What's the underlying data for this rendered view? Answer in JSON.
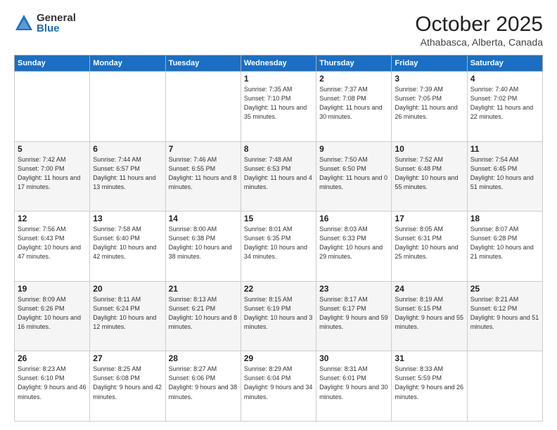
{
  "logo": {
    "general": "General",
    "blue": "Blue"
  },
  "header": {
    "month": "October 2025",
    "location": "Athabasca, Alberta, Canada"
  },
  "days_of_week": [
    "Sunday",
    "Monday",
    "Tuesday",
    "Wednesday",
    "Thursday",
    "Friday",
    "Saturday"
  ],
  "weeks": [
    [
      {
        "day": "",
        "info": ""
      },
      {
        "day": "",
        "info": ""
      },
      {
        "day": "",
        "info": ""
      },
      {
        "day": "1",
        "info": "Sunrise: 7:35 AM\nSunset: 7:10 PM\nDaylight: 11 hours\nand 35 minutes."
      },
      {
        "day": "2",
        "info": "Sunrise: 7:37 AM\nSunset: 7:08 PM\nDaylight: 11 hours\nand 30 minutes."
      },
      {
        "day": "3",
        "info": "Sunrise: 7:39 AM\nSunset: 7:05 PM\nDaylight: 11 hours\nand 26 minutes."
      },
      {
        "day": "4",
        "info": "Sunrise: 7:40 AM\nSunset: 7:02 PM\nDaylight: 11 hours\nand 22 minutes."
      }
    ],
    [
      {
        "day": "5",
        "info": "Sunrise: 7:42 AM\nSunset: 7:00 PM\nDaylight: 11 hours\nand 17 minutes."
      },
      {
        "day": "6",
        "info": "Sunrise: 7:44 AM\nSunset: 6:57 PM\nDaylight: 11 hours\nand 13 minutes."
      },
      {
        "day": "7",
        "info": "Sunrise: 7:46 AM\nSunset: 6:55 PM\nDaylight: 11 hours\nand 8 minutes."
      },
      {
        "day": "8",
        "info": "Sunrise: 7:48 AM\nSunset: 6:53 PM\nDaylight: 11 hours\nand 4 minutes."
      },
      {
        "day": "9",
        "info": "Sunrise: 7:50 AM\nSunset: 6:50 PM\nDaylight: 11 hours\nand 0 minutes."
      },
      {
        "day": "10",
        "info": "Sunrise: 7:52 AM\nSunset: 6:48 PM\nDaylight: 10 hours\nand 55 minutes."
      },
      {
        "day": "11",
        "info": "Sunrise: 7:54 AM\nSunset: 6:45 PM\nDaylight: 10 hours\nand 51 minutes."
      }
    ],
    [
      {
        "day": "12",
        "info": "Sunrise: 7:56 AM\nSunset: 6:43 PM\nDaylight: 10 hours\nand 47 minutes."
      },
      {
        "day": "13",
        "info": "Sunrise: 7:58 AM\nSunset: 6:40 PM\nDaylight: 10 hours\nand 42 minutes."
      },
      {
        "day": "14",
        "info": "Sunrise: 8:00 AM\nSunset: 6:38 PM\nDaylight: 10 hours\nand 38 minutes."
      },
      {
        "day": "15",
        "info": "Sunrise: 8:01 AM\nSunset: 6:35 PM\nDaylight: 10 hours\nand 34 minutes."
      },
      {
        "day": "16",
        "info": "Sunrise: 8:03 AM\nSunset: 6:33 PM\nDaylight: 10 hours\nand 29 minutes."
      },
      {
        "day": "17",
        "info": "Sunrise: 8:05 AM\nSunset: 6:31 PM\nDaylight: 10 hours\nand 25 minutes."
      },
      {
        "day": "18",
        "info": "Sunrise: 8:07 AM\nSunset: 6:28 PM\nDaylight: 10 hours\nand 21 minutes."
      }
    ],
    [
      {
        "day": "19",
        "info": "Sunrise: 8:09 AM\nSunset: 6:26 PM\nDaylight: 10 hours\nand 16 minutes."
      },
      {
        "day": "20",
        "info": "Sunrise: 8:11 AM\nSunset: 6:24 PM\nDaylight: 10 hours\nand 12 minutes."
      },
      {
        "day": "21",
        "info": "Sunrise: 8:13 AM\nSunset: 6:21 PM\nDaylight: 10 hours\nand 8 minutes."
      },
      {
        "day": "22",
        "info": "Sunrise: 8:15 AM\nSunset: 6:19 PM\nDaylight: 10 hours\nand 3 minutes."
      },
      {
        "day": "23",
        "info": "Sunrise: 8:17 AM\nSunset: 6:17 PM\nDaylight: 9 hours\nand 59 minutes."
      },
      {
        "day": "24",
        "info": "Sunrise: 8:19 AM\nSunset: 6:15 PM\nDaylight: 9 hours\nand 55 minutes."
      },
      {
        "day": "25",
        "info": "Sunrise: 8:21 AM\nSunset: 6:12 PM\nDaylight: 9 hours\nand 51 minutes."
      }
    ],
    [
      {
        "day": "26",
        "info": "Sunrise: 8:23 AM\nSunset: 6:10 PM\nDaylight: 9 hours\nand 46 minutes."
      },
      {
        "day": "27",
        "info": "Sunrise: 8:25 AM\nSunset: 6:08 PM\nDaylight: 9 hours\nand 42 minutes."
      },
      {
        "day": "28",
        "info": "Sunrise: 8:27 AM\nSunset: 6:06 PM\nDaylight: 9 hours\nand 38 minutes."
      },
      {
        "day": "29",
        "info": "Sunrise: 8:29 AM\nSunset: 6:04 PM\nDaylight: 9 hours\nand 34 minutes."
      },
      {
        "day": "30",
        "info": "Sunrise: 8:31 AM\nSunset: 6:01 PM\nDaylight: 9 hours\nand 30 minutes."
      },
      {
        "day": "31",
        "info": "Sunrise: 8:33 AM\nSunset: 5:59 PM\nDaylight: 9 hours\nand 26 minutes."
      },
      {
        "day": "",
        "info": ""
      }
    ]
  ]
}
